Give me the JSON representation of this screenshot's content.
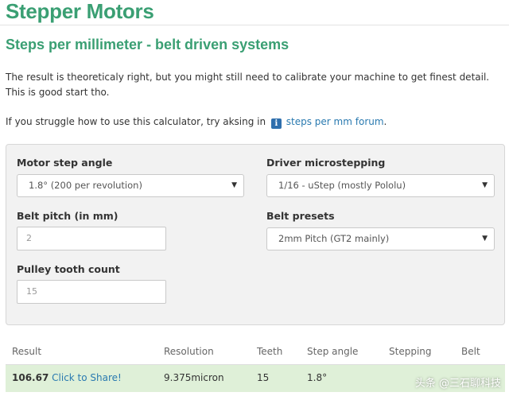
{
  "header": {
    "title": "Stepper Motors",
    "subtitle": "Steps per millimeter - belt driven systems"
  },
  "intro": {
    "paragraph1": "The result is theoreticaly right, but you might still need to calibrate your machine to get finest detail. This is good start tho.",
    "paragraph2_prefix": "If you struggle how to use this calculator, try aksing in",
    "info_icon_glyph": "i",
    "forum_link": "steps per mm forum",
    "paragraph2_suffix": "."
  },
  "form": {
    "motor_step_angle": {
      "label": "Motor step angle",
      "value": "1.8° (200 per revolution)"
    },
    "driver_microstepping": {
      "label": "Driver microstepping",
      "value": "1/16 - uStep (mostly Pololu)"
    },
    "belt_pitch": {
      "label": "Belt pitch (in mm)",
      "placeholder": "2"
    },
    "belt_presets": {
      "label": "Belt presets",
      "value": "2mm Pitch (GT2 mainly)"
    },
    "pulley_tooth_count": {
      "label": "Pulley tooth count",
      "placeholder": "15"
    },
    "caret_glyph": "▼"
  },
  "results": {
    "headers": [
      "Result",
      "Resolution",
      "Teeth",
      "Step angle",
      "Stepping",
      "Belt"
    ],
    "row": {
      "result": "106.67",
      "share_link": "Click to Share!",
      "resolution": "9.375micron",
      "teeth": "15",
      "step_angle": "1.8°"
    }
  },
  "watermark": "头条 @三石聊科技",
  "colors": {
    "accent_green": "#3a9f73",
    "link_blue": "#2a7ab0",
    "result_row_bg": "#dff0d8",
    "panel_bg": "#f2f2f2"
  }
}
